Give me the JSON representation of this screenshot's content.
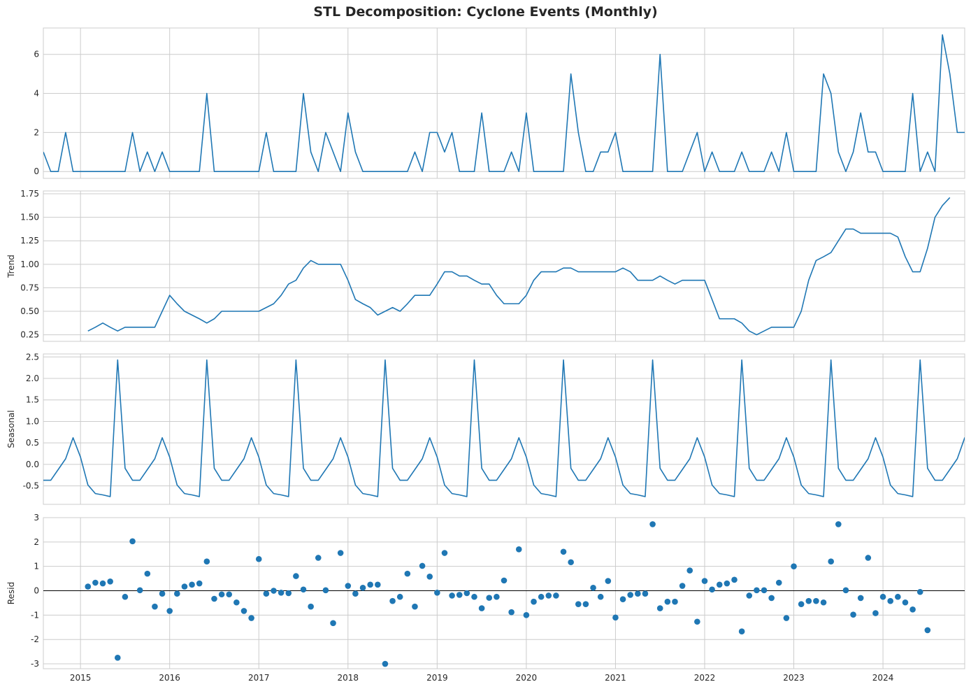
{
  "title": "STL Decomposition: Cyclone Events (Monthly)",
  "colors": {
    "series": "#1f77b4",
    "grid": "#cccccc",
    "frame": "#cccccc",
    "zero_line": "#000000"
  },
  "chart_data": [
    {
      "type": "line",
      "panel": "observed",
      "ylabel": "",
      "ylim": [
        -0.35,
        7.35
      ],
      "yticks": [
        0,
        2,
        4,
        6
      ],
      "x_start": "2014-08",
      "x_end": "2024-12",
      "xlim": [
        "2014-08",
        "2024-12"
      ],
      "xticks": [
        "2015",
        "2016",
        "2017",
        "2018",
        "2019",
        "2020",
        "2021",
        "2022",
        "2023",
        "2024"
      ],
      "grid": true,
      "values": [
        1,
        0,
        0,
        2,
        0,
        0,
        0,
        0,
        0,
        0,
        0,
        0,
        2,
        0,
        1,
        0,
        1,
        0,
        0,
        0,
        0,
        0,
        4,
        0,
        0,
        0,
        0,
        0,
        0,
        0,
        2,
        0,
        0,
        0,
        0,
        4,
        1,
        0,
        2,
        1,
        0,
        3,
        1,
        0,
        0,
        0,
        0,
        0,
        0,
        0,
        1,
        0,
        2,
        2,
        1,
        2,
        0,
        0,
        0,
        3,
        0,
        0,
        0,
        1,
        0,
        3,
        0,
        0,
        0,
        0,
        0,
        5,
        2,
        0,
        0,
        1,
        1,
        2,
        0,
        0,
        0,
        0,
        0,
        6,
        0,
        0,
        0,
        1,
        2,
        0,
        1,
        0,
        0,
        0,
        1,
        0,
        0,
        0,
        1,
        0,
        2,
        0,
        0,
        0,
        0,
        5,
        4,
        1,
        0,
        1,
        3,
        1,
        1,
        0,
        0,
        0,
        0,
        4,
        0,
        1,
        0,
        7,
        5,
        2,
        2
      ]
    },
    {
      "type": "line",
      "panel": "trend",
      "ylabel": "Trend",
      "ylim": [
        0.18,
        1.78
      ],
      "yticks": [
        "0.25",
        "0.50",
        "0.75",
        "1.00",
        "1.25",
        "1.50",
        "1.75"
      ],
      "x_start": "2015-02",
      "grid": true,
      "values": [
        0.29,
        0.33,
        0.375,
        0.33,
        0.29,
        0.33,
        0.33,
        0.33,
        0.33,
        0.33,
        0.5,
        0.67,
        0.58,
        0.5,
        0.46,
        0.42,
        0.375,
        0.42,
        0.5,
        0.5,
        0.5,
        0.5,
        0.5,
        0.5,
        0.54,
        0.58,
        0.67,
        0.79,
        0.83,
        0.96,
        1.04,
        1.0,
        1.0,
        1.0,
        1.0,
        0.83,
        0.625,
        0.58,
        0.54,
        0.46,
        0.5,
        0.54,
        0.5,
        0.58,
        0.67,
        0.67,
        0.67,
        0.79,
        0.92,
        0.92,
        0.875,
        0.875,
        0.83,
        0.79,
        0.79,
        0.67,
        0.58,
        0.58,
        0.58,
        0.67,
        0.83,
        0.92,
        0.92,
        0.92,
        0.96,
        0.96,
        0.92,
        0.92,
        0.92,
        0.92,
        0.92,
        0.92,
        0.96,
        0.92,
        0.83,
        0.83,
        0.83,
        0.875,
        0.83,
        0.79,
        0.83,
        0.83,
        0.83,
        0.83,
        0.625,
        0.42,
        0.42,
        0.42,
        0.375,
        0.29,
        0.25,
        0.29,
        0.33,
        0.33,
        0.33,
        0.33,
        0.5,
        0.83,
        1.04,
        1.08,
        1.125,
        1.25,
        1.375,
        1.375,
        1.33,
        1.33,
        1.33,
        1.33,
        1.33,
        1.29,
        1.08,
        0.92,
        0.92,
        1.17,
        1.5,
        1.625,
        1.71
      ]
    },
    {
      "type": "line",
      "panel": "seasonal",
      "ylabel": "Seasonal",
      "ylim": [
        -0.93,
        2.57
      ],
      "yticks": [
        "-0.5",
        "0.0",
        "0.5",
        "1.0",
        "1.5",
        "2.0",
        "2.5"
      ],
      "x_start": "2014-08",
      "grid": true,
      "values": [
        -0.37,
        -0.37,
        -0.12,
        0.13,
        0.62,
        0.17,
        -0.48,
        -0.68,
        -0.71,
        -0.75,
        2.43,
        -0.09,
        -0.37,
        -0.37,
        -0.12,
        0.13,
        0.62,
        0.17,
        -0.48,
        -0.68,
        -0.71,
        -0.75,
        2.43,
        -0.09,
        -0.37,
        -0.37,
        -0.12,
        0.13,
        0.62,
        0.17,
        -0.48,
        -0.68,
        -0.71,
        -0.75,
        2.43,
        -0.09,
        -0.37,
        -0.37,
        -0.12,
        0.13,
        0.62,
        0.17,
        -0.48,
        -0.68,
        -0.71,
        -0.75,
        2.43,
        -0.09,
        -0.37,
        -0.37,
        -0.12,
        0.13,
        0.62,
        0.17,
        -0.48,
        -0.68,
        -0.71,
        -0.75,
        2.43,
        -0.09,
        -0.37,
        -0.37,
        -0.12,
        0.13,
        0.62,
        0.17,
        -0.48,
        -0.68,
        -0.71,
        -0.75,
        2.43,
        -0.09,
        -0.37,
        -0.37,
        -0.12,
        0.13,
        0.62,
        0.17,
        -0.48,
        -0.68,
        -0.71,
        -0.75,
        2.43,
        -0.09,
        -0.37,
        -0.37,
        -0.12,
        0.13,
        0.62,
        0.17,
        -0.48,
        -0.68,
        -0.71,
        -0.75,
        2.43,
        -0.09,
        -0.37,
        -0.37,
        -0.12,
        0.13,
        0.62,
        0.17,
        -0.48,
        -0.68,
        -0.71,
        -0.75,
        2.43,
        -0.09,
        -0.37,
        -0.37,
        -0.12,
        0.13,
        0.62,
        0.17,
        -0.48,
        -0.68,
        -0.71,
        -0.75,
        2.43,
        -0.09,
        -0.37,
        -0.37,
        -0.12,
        0.13,
        0.62,
        0.17
      ]
    },
    {
      "type": "scatter",
      "panel": "resid",
      "ylabel": "Resid",
      "ylim": [
        -3.2,
        3.0
      ],
      "yticks": [
        "-3",
        "-2",
        "-1",
        "0",
        "1",
        "2",
        "3"
      ],
      "x_start": "2015-02",
      "grid": true,
      "zero_line": true,
      "values": [
        0.17,
        0.33,
        0.3,
        0.38,
        -2.75,
        -0.25,
        2.03,
        0.02,
        0.7,
        -0.65,
        -0.12,
        -0.83,
        -0.12,
        0.17,
        0.25,
        0.3,
        1.2,
        -0.33,
        -0.15,
        -0.15,
        -0.48,
        -0.83,
        -1.12,
        1.3,
        -0.12,
        0.0,
        -0.08,
        -0.1,
        0.6,
        0.05,
        -0.65,
        1.35,
        0.02,
        -1.33,
        1.55,
        0.2,
        -0.12,
        0.12,
        0.25,
        0.25,
        -3.0,
        -0.42,
        -0.25,
        0.7,
        -0.65,
        1.02,
        0.58,
        -0.08,
        1.55,
        -0.2,
        -0.17,
        -0.1,
        -0.25,
        -0.72,
        -0.29,
        -0.25,
        0.42,
        -0.88,
        1.7,
        -1.0,
        -0.45,
        -0.25,
        -0.2,
        -0.2,
        1.6,
        1.17,
        -0.55,
        -0.55,
        0.12,
        -0.25,
        0.4,
        -1.1,
        -0.35,
        -0.17,
        -0.12,
        -0.12,
        2.73,
        -0.72,
        -0.45,
        -0.45,
        0.2,
        0.83,
        -1.27,
        0.4,
        0.05,
        0.25,
        0.3,
        0.45,
        -1.67,
        -0.2,
        0.02,
        0.02,
        -0.3,
        0.33,
        -1.12,
        1.0,
        -0.55,
        -0.42,
        -0.42,
        -0.48,
        1.2,
        2.73,
        0.02,
        -0.98,
        -0.3,
        1.35,
        -0.92,
        -0.25,
        -0.42,
        -0.25,
        -0.48,
        -0.77,
        -0.05,
        -1.62
      ]
    }
  ]
}
